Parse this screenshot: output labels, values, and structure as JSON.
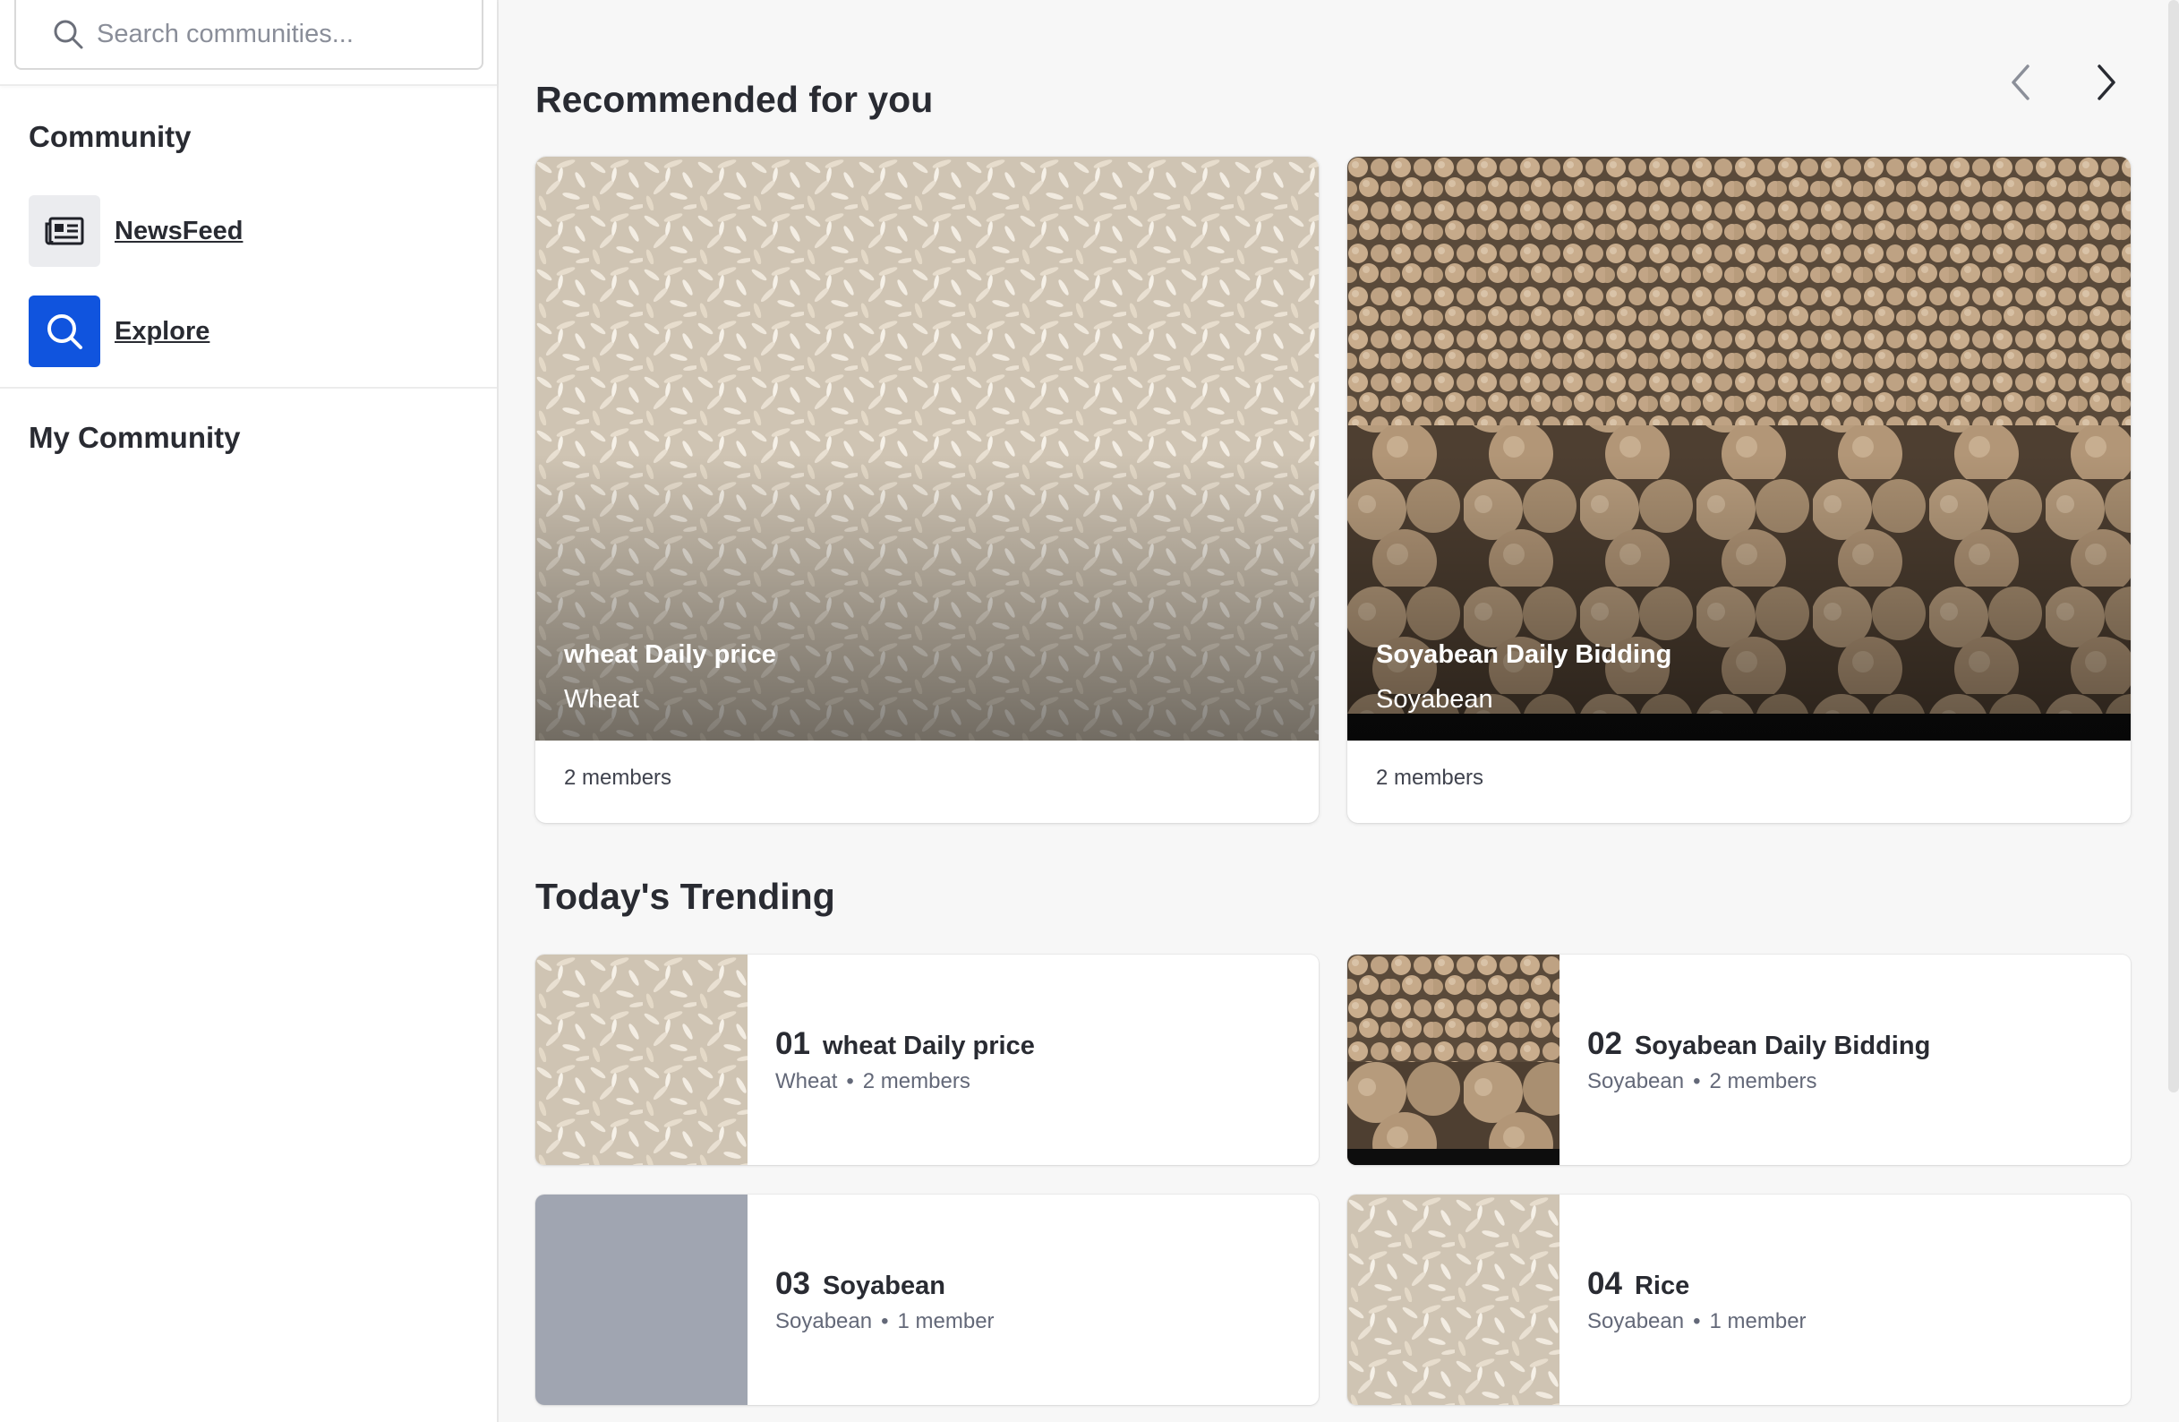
{
  "search": {
    "placeholder": "Search communities..."
  },
  "sidebar": {
    "community_title": "Community",
    "items": [
      {
        "label": "NewsFeed",
        "icon": "newspaper-icon"
      },
      {
        "label": "Explore",
        "icon": "search-icon"
      }
    ],
    "my_community_title": "My Community"
  },
  "colors": {
    "accent": "#1054de",
    "placeholder_thumb": "#a0a5b1"
  },
  "recommended": {
    "title": "Recommended for you",
    "cards": [
      {
        "name": "wheat Daily price",
        "category": "Wheat",
        "members": "2 members",
        "image": "wheat-grains"
      },
      {
        "name": "Soyabean Daily Bidding",
        "category": "Soyabean",
        "members": "2 members",
        "image": "soyabean-grains"
      }
    ]
  },
  "trending": {
    "title": "Today's Trending",
    "items": [
      {
        "rank": "01",
        "name": "wheat Daily price",
        "category": "Wheat",
        "members": "2 members",
        "image": "wheat-grains"
      },
      {
        "rank": "02",
        "name": "Soyabean Daily Bidding",
        "category": "Soyabean",
        "members": "2 members",
        "image": "soyabean-grains"
      },
      {
        "rank": "03",
        "name": "Soyabean",
        "category": "Soyabean",
        "members": "1 member",
        "image": "placeholder"
      },
      {
        "rank": "04",
        "name": "Rice",
        "category": "Soyabean",
        "members": "1 member",
        "image": "wheat-grains"
      }
    ]
  }
}
